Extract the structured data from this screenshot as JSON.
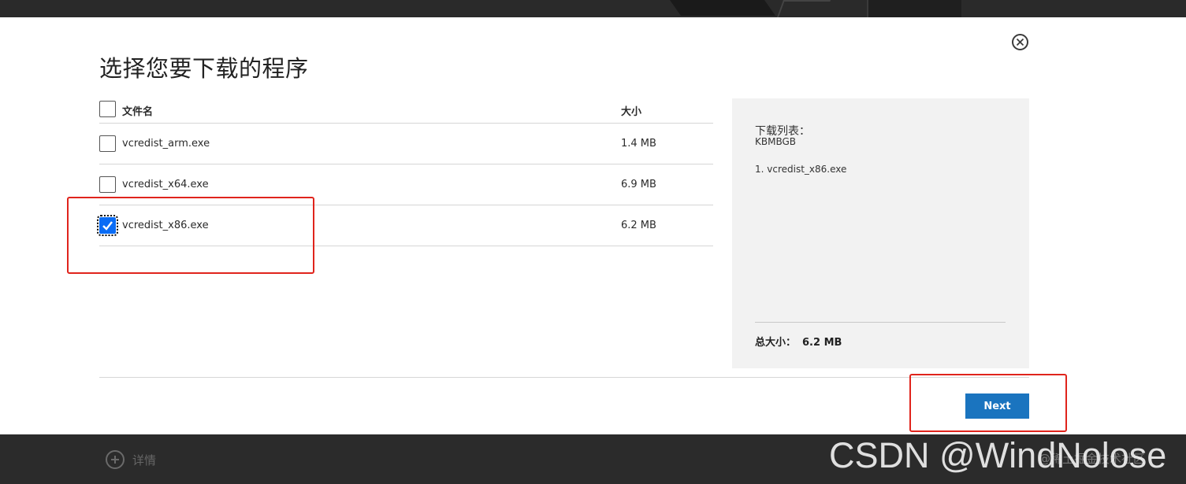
{
  "dialog": {
    "title": "选择您要下载的程序",
    "close_icon": "close-circle-icon"
  },
  "table": {
    "header": {
      "name": "文件名",
      "size": "大小",
      "checked": false
    },
    "rows": [
      {
        "name": "vcredist_arm.exe",
        "size": "1.4 MB",
        "checked": false
      },
      {
        "name": "vcredist_x64.exe",
        "size": "6.9 MB",
        "checked": false
      },
      {
        "name": "vcredist_x86.exe",
        "size": "6.2 MB",
        "checked": true
      }
    ]
  },
  "download_list": {
    "label": "下载列表：",
    "kb": "KBMBGB",
    "items": [
      "1. vcredist_x86.exe"
    ],
    "total_label": "总大小：",
    "total_value": "6.2 MB"
  },
  "buttons": {
    "next": "Next"
  },
  "details": {
    "label": "详情",
    "icon": "plus-circle-icon"
  },
  "watermark": {
    "text": "CSDN @WindNolose",
    "subtext": "@稀土掘金技术社区"
  },
  "colors": {
    "accent": "#1a74bf",
    "checkbox_checked": "#0a6cf5",
    "annotation": "#e0241c",
    "side_panel_bg": "#f2f2f2",
    "page_bar": "#2b2b2b"
  }
}
